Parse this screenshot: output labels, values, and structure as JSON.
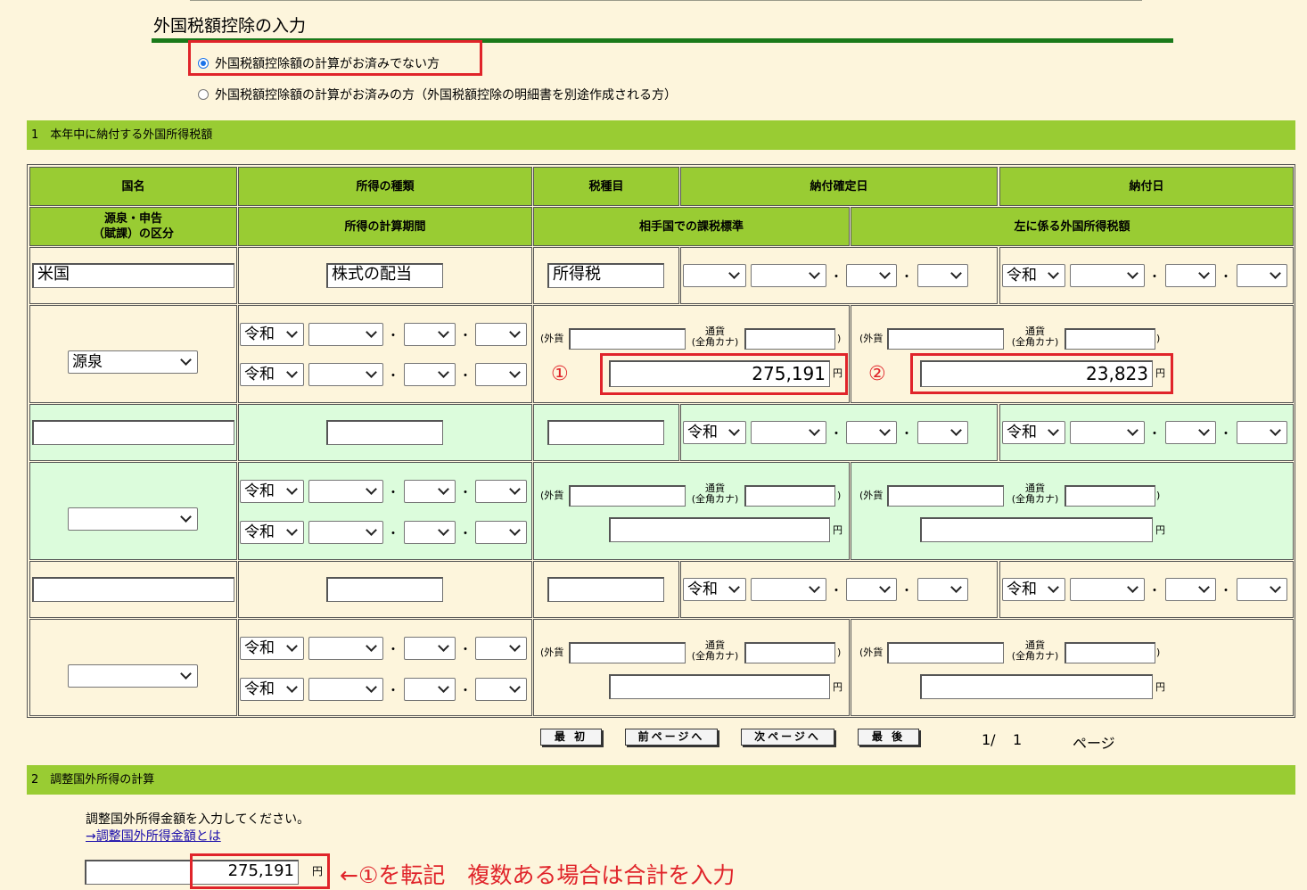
{
  "page": {
    "title": "外国税額控除の入力",
    "radio_options": [
      {
        "label": "外国税額控除額の計算がお済みでない方",
        "selected": true
      },
      {
        "label": "外国税額控除額の計算がお済みの方（外国税額控除の明細書を別途作成される方）",
        "selected": false
      }
    ]
  },
  "section1": {
    "title": "1　本年中に納付する外国所得税額",
    "headers_row1": [
      "国名",
      "所得の種類",
      "税種目",
      "納付確定日",
      "納付日"
    ],
    "headers_row2": [
      "源泉・申告\n（賦課）の区分",
      "所得の計算期間",
      "相手国での課税標準",
      "左に係る外国所得税額"
    ],
    "labels": {
      "currency_prefix": "(外貨",
      "currency_name_top": "通貨",
      "currency_name_bottom": "(全角カナ)",
      "close_paren": ")",
      "yen": "円",
      "era": "令和",
      "dot": "・"
    },
    "entries": [
      {
        "country": "米国",
        "income_type": "株式の配当",
        "tax_item": "所得税",
        "pay_confirm_era": "",
        "pay_era": "令和",
        "category": "源泉",
        "period_era1": "令和",
        "period_era2": "令和",
        "taxable_base": "275,191",
        "foreign_tax": "23,823",
        "marker_base": "①",
        "marker_tax": "②"
      },
      {
        "country": "",
        "income_type": "",
        "tax_item": "",
        "pay_confirm_era": "令和",
        "pay_era": "令和",
        "category": "",
        "period_era1": "令和",
        "period_era2": "令和",
        "taxable_base": "",
        "foreign_tax": ""
      },
      {
        "country": "",
        "income_type": "",
        "tax_item": "",
        "pay_confirm_era": "令和",
        "pay_era": "令和",
        "category": "",
        "period_era1": "令和",
        "period_era2": "令和",
        "taxable_base": "",
        "foreign_tax": ""
      }
    ],
    "nav": {
      "first": "最 初",
      "prev": "前ページへ",
      "next": "次ページへ",
      "last": "最 後",
      "page_current": "1/",
      "page_total": "1",
      "page_label": "ページ"
    }
  },
  "section2": {
    "title": "2　調整国外所得の計算",
    "instruction": "調整国外所得金額を入力してください。",
    "link": "→調整国外所得金額とは",
    "amount": "275,191",
    "yen": "円",
    "annotation": "←①を転記　複数ある場合は合計を入力"
  },
  "colors": {
    "header_green": "#99cc33",
    "row_green": "#dcfcdc",
    "background": "#fdf5dc",
    "title_rule": "#1a7a1a",
    "highlight_red": "#e0242a"
  }
}
